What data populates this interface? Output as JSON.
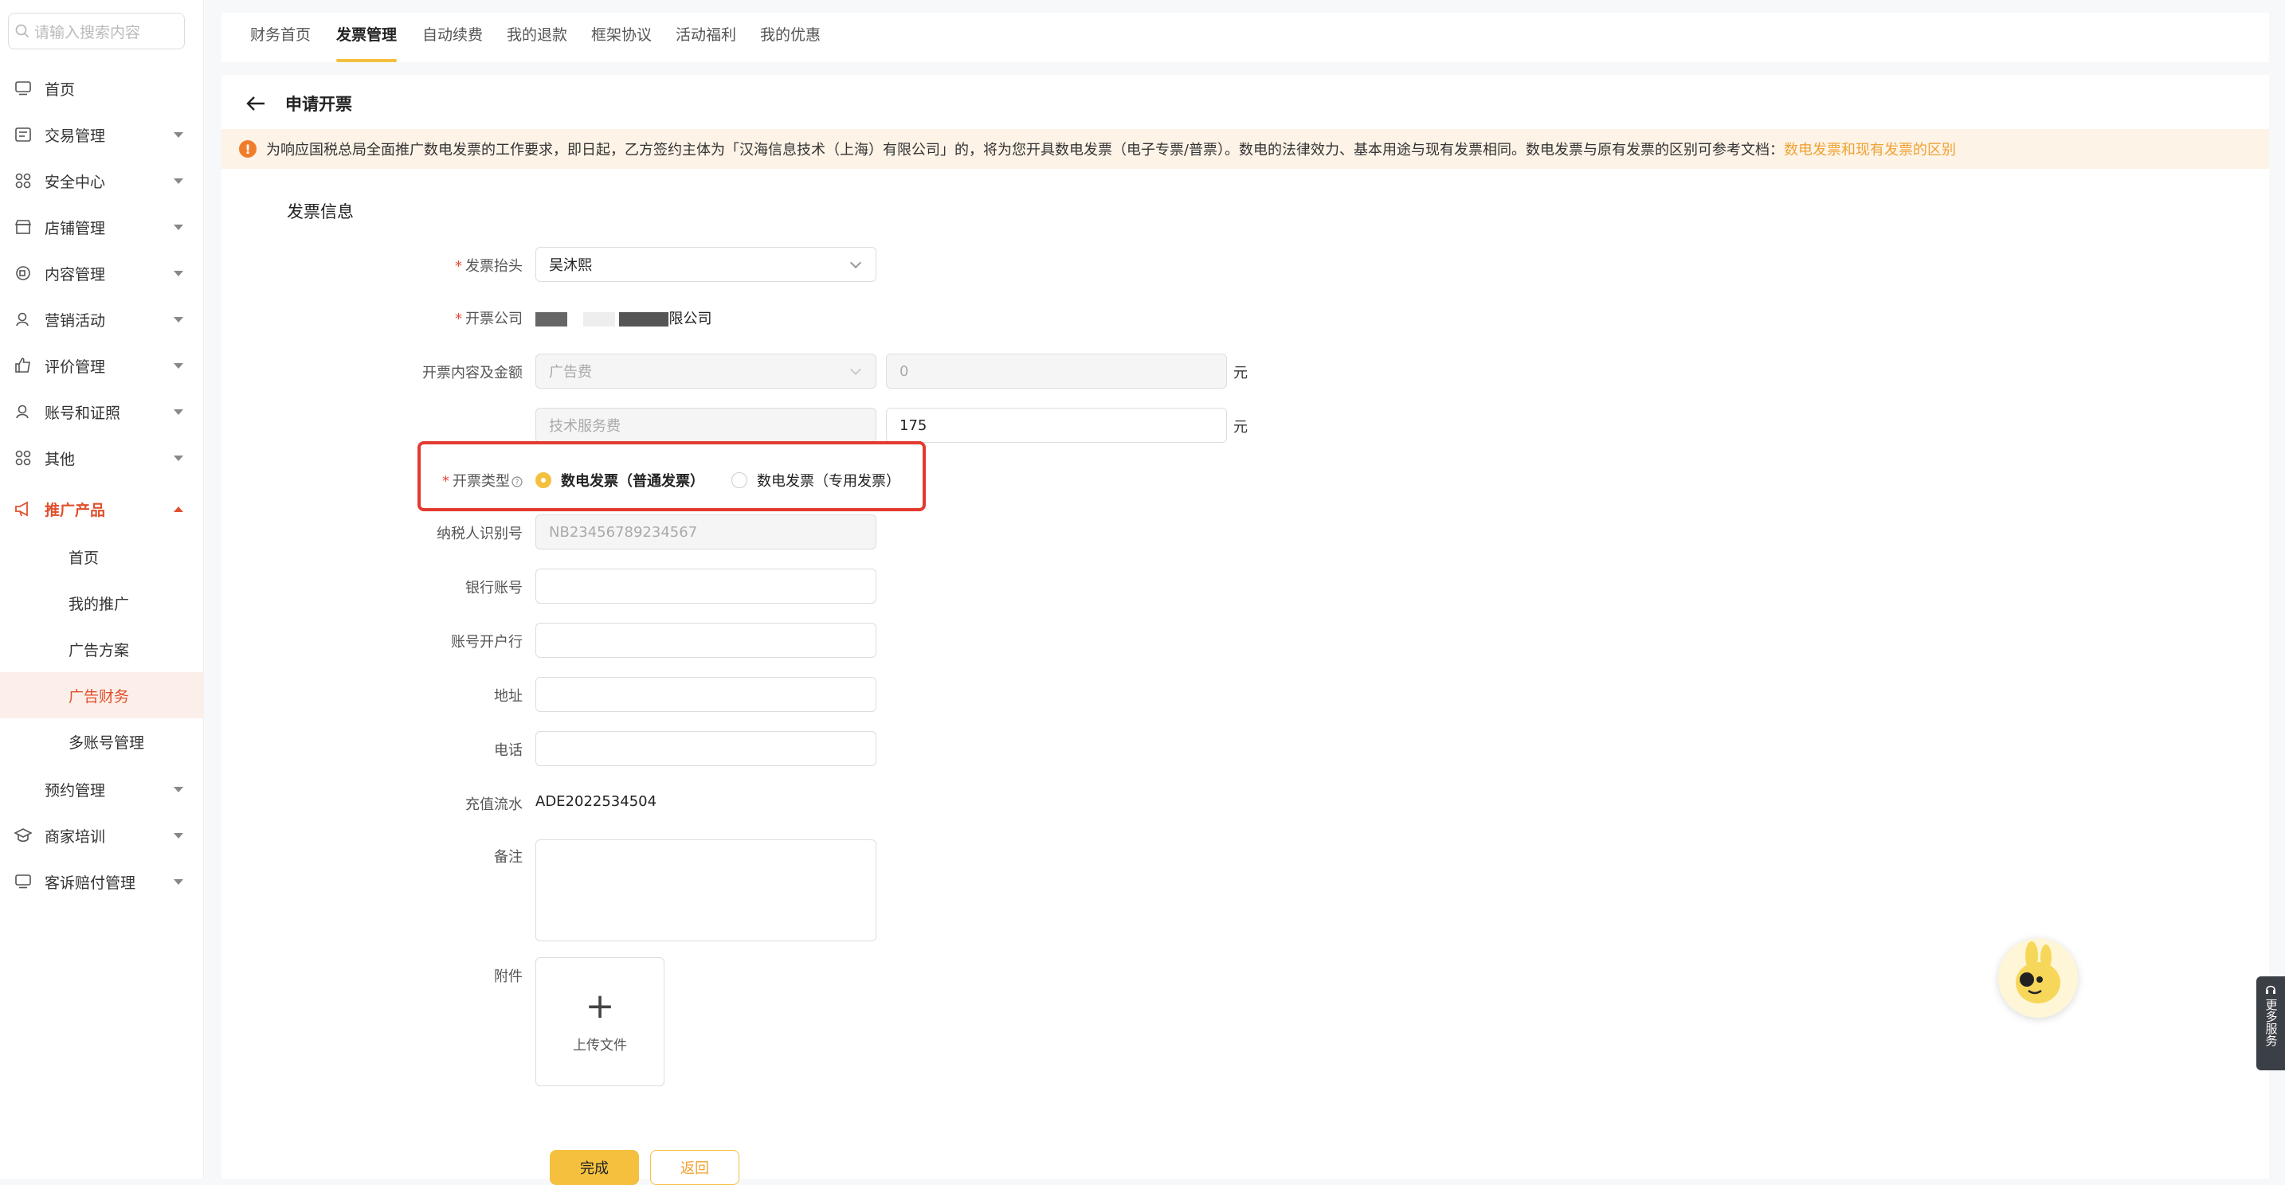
{
  "sidebar": {
    "search_placeholder": "请输入搜索内容",
    "items": [
      {
        "label": "首页",
        "icon": "monitor-icon"
      },
      {
        "label": "交易管理",
        "icon": "list-icon"
      },
      {
        "label": "安全中心",
        "icon": "grid-icon"
      },
      {
        "label": "店铺管理",
        "icon": "store-icon"
      },
      {
        "label": "内容管理",
        "icon": "content-icon"
      },
      {
        "label": "营销活动",
        "icon": "user-icon"
      },
      {
        "label": "评价管理",
        "icon": "thumb-up-icon"
      },
      {
        "label": "账号和证照",
        "icon": "account-icon"
      },
      {
        "label": "其他",
        "icon": "grid-icon"
      },
      {
        "label": "推广产品",
        "icon": "megaphone-icon"
      }
    ],
    "sub_items": [
      {
        "label": "首页"
      },
      {
        "label": "我的推广"
      },
      {
        "label": "广告方案"
      },
      {
        "label": "广告财务"
      },
      {
        "label": "多账号管理"
      }
    ],
    "items_after": [
      {
        "label": "预约管理"
      },
      {
        "label": "商家培训",
        "icon": "school-icon"
      },
      {
        "label": "客诉赔付管理",
        "icon": "monitor-icon"
      }
    ]
  },
  "tabs": [
    "财务首页",
    "发票管理",
    "自动续费",
    "我的退款",
    "框架协议",
    "活动福利",
    "我的优惠"
  ],
  "page": {
    "title": "申请开票",
    "notice_text": "为响应国税总局全面推广数电发票的工作要求，即日起，乙方签约主体为「汉海信息技术（上海）有限公司」的，将为您开具数电发票（电子专票/普票）。数电的法律效力、基本用途与现有发票相同。数电发票与原有发票的区别可参考文档：",
    "notice_link": "数电发票和现有发票的区别",
    "section_title": "发票信息"
  },
  "form": {
    "title_label": "发票抬头",
    "title_value": "吴沐熙",
    "company_label": "开票公司",
    "company_suffix": "限公司",
    "content_label": "开票内容及金额",
    "content1_value": "广告费",
    "amount1_value": "0",
    "content2_value": "技术服务费",
    "amount2_value": "175",
    "yuan": "元",
    "type_label": "开票类型",
    "type_options": [
      "数电发票（普通发票）",
      "数电发票（专用发票）"
    ],
    "taxid_label": "纳税人识别号",
    "taxid_value": "NB23456789234567",
    "bank_account_label": "银行账号",
    "bank_label": "账号开户行",
    "address_label": "地址",
    "phone_label": "电话",
    "recharge_label": "充值流水",
    "recharge_value": "ADE2022534504",
    "remark_label": "备注",
    "attach_label": "附件",
    "upload_label": "上传文件",
    "submit_label": "完成",
    "back_label": "返回"
  },
  "float": {
    "more_services": "更多服务"
  },
  "colors": {
    "accent": "#f4c03e",
    "active": "#e0502d",
    "highlight_box": "#e33a2f"
  }
}
